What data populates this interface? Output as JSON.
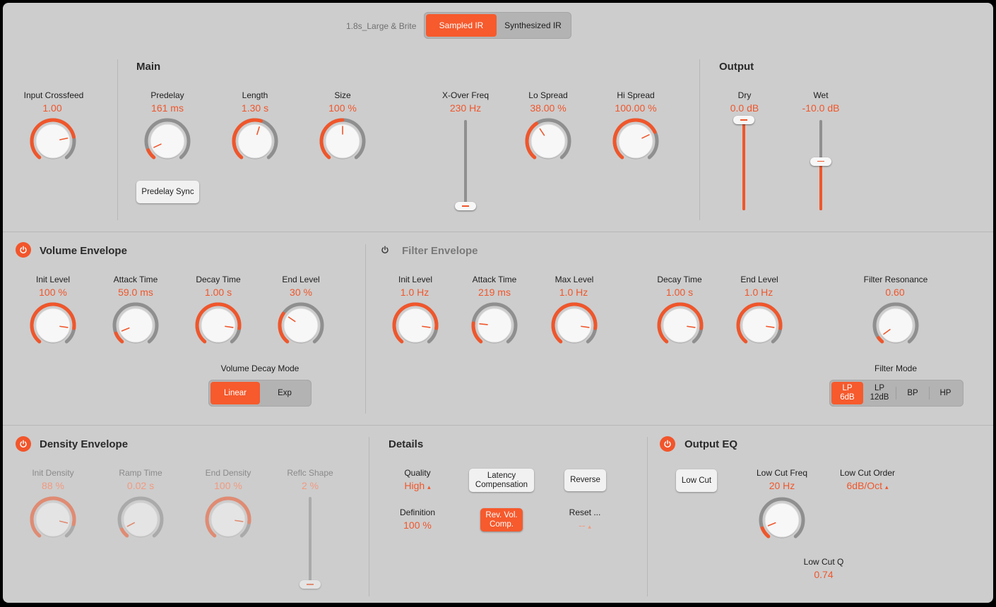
{
  "header": {
    "preset_name": "1.8s_Large & Brite",
    "mode_sampled": "Sampled IR",
    "mode_synth": "Synthesized IR"
  },
  "colors": {
    "accent": "#f0562b",
    "panel": "#cdcdcd",
    "track": "#8f8f8f"
  },
  "input_crossfeed": {
    "label": "Input Crossfeed",
    "value": "1.00",
    "level": 0.78
  },
  "main": {
    "title": "Main",
    "predelay": {
      "label": "Predelay",
      "value": "161 ms",
      "level": 0.09
    },
    "length": {
      "label": "Length",
      "value": "1.30 s",
      "level": 0.56
    },
    "size": {
      "label": "Size",
      "value": "100 %",
      "level": 0.5
    },
    "predelay_sync_label": "Predelay Sync",
    "xover": {
      "label": "X-Over Freq",
      "value": "230 Hz",
      "level": 0.0
    },
    "lo_spread": {
      "label": "Lo Spread",
      "value": "38.00 %",
      "level": 0.38
    },
    "hi_spread": {
      "label": "Hi Spread",
      "value": "100.00 %",
      "level": 0.73
    }
  },
  "output": {
    "title": "Output",
    "dry": {
      "label": "Dry",
      "value": "0.0 dB",
      "level": 1.0
    },
    "wet": {
      "label": "Wet",
      "value": "-10.0 dB",
      "level": 0.52
    }
  },
  "volume_env": {
    "title": "Volume Envelope",
    "init_level": {
      "label": "Init Level",
      "value": "100 %",
      "level": 0.85
    },
    "attack": {
      "label": "Attack Time",
      "value": "59.0 ms",
      "level": 0.1
    },
    "decay": {
      "label": "Decay Time",
      "value": "1.00 s",
      "level": 0.85
    },
    "end_level": {
      "label": "End Level",
      "value": "30 %",
      "level": 0.3
    },
    "decay_mode_label": "Volume Decay Mode",
    "decay_mode_linear": "Linear",
    "decay_mode_exp": "Exp"
  },
  "filter_env": {
    "title": "Filter Envelope",
    "init_level": {
      "label": "Init Level",
      "value": "1.0 Hz",
      "level": 0.85
    },
    "attack": {
      "label": "Attack Time",
      "value": "219 ms",
      "level": 0.2
    },
    "max_level": {
      "label": "Max Level",
      "value": "1.0 Hz",
      "level": 0.85
    },
    "decay": {
      "label": "Decay Time",
      "value": "1.00 s",
      "level": 0.85
    },
    "end_level": {
      "label": "End Level",
      "value": "1.0 Hz",
      "level": 0.85
    },
    "resonance": {
      "label": "Filter Resonance",
      "value": "0.60",
      "level": 0.05
    },
    "filter_mode_label": "Filter Mode",
    "modes": [
      {
        "line1": "LP",
        "line2": "6dB"
      },
      {
        "line1": "LP",
        "line2": "12dB"
      },
      {
        "line1": "BP",
        "line2": ""
      },
      {
        "line1": "HP",
        "line2": ""
      }
    ]
  },
  "density_env": {
    "title": "Density Envelope",
    "init_density": {
      "label": "Init Density",
      "value": "88 %",
      "level": 0.87
    },
    "ramp": {
      "label": "Ramp Time",
      "value": "0.02 s",
      "level": 0.08
    },
    "end_density": {
      "label": "End Density",
      "value": "100 %",
      "level": 0.85
    },
    "reflc_shape": {
      "label": "Reflc Shape",
      "value": "2 %",
      "level": 0.0
    }
  },
  "details": {
    "title": "Details",
    "quality_label": "Quality",
    "quality_value": "High",
    "latency_line1": "Latency",
    "latency_line2": "Compensation",
    "reverse_label": "Reverse",
    "definition_label": "Definition",
    "definition_value": "100 %",
    "revvol_line1": "Rev. Vol.",
    "revvol_line2": "Comp.",
    "reset_label": "Reset ...",
    "reset_value": "--"
  },
  "output_eq": {
    "title": "Output EQ",
    "low_cut_label": "Low Cut",
    "low_cut_freq": {
      "label": "Low Cut Freq",
      "value": "20 Hz",
      "level": 0.1
    },
    "low_cut_order_label": "Low Cut Order",
    "low_cut_order_value": "6dB/Oct",
    "low_cut_q_label": "Low Cut Q",
    "low_cut_q_value": "0.74"
  }
}
